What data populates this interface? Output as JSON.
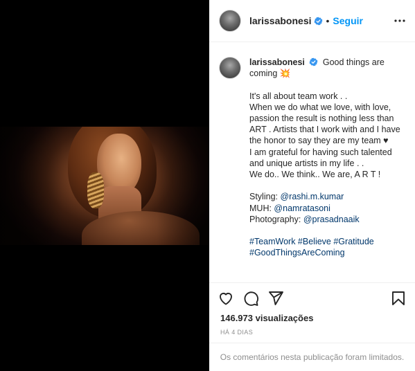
{
  "post": {
    "username": "larissabonesi",
    "follow_label": "Seguir",
    "dot": "•",
    "caption_lines": [
      "Good things are coming ",
      "It's all about team work . .",
      "When we do what we love, with love, passion the result is nothing less than ART . Artists that I work with and I have the honor to say they are my team ♥",
      "I am grateful for having such talented and unique artists in my life . .",
      "We do.. We think.. We are, A R T !"
    ],
    "emoji": "💥",
    "credits": [
      {
        "label": "Styling: ",
        "handle": "@rashi.m.kumar"
      },
      {
        "label": "MUH: ",
        "handle": "@namratasoni"
      },
      {
        "label": "Photography: ",
        "handle": "@prasadnaaik"
      }
    ],
    "hashtags_line1": "#TeamWork #Believe #Gratitude",
    "hashtags_line2": "#GoodThingsAreComing",
    "views_count": "146.973",
    "views_label": " visualizações",
    "time_ago": "HÁ 4 DIAS",
    "comments_limited": "Os comentários nesta publicação foram limitados."
  },
  "icons": {
    "like": "heart-icon",
    "comment": "comment-icon",
    "share": "share-icon",
    "save": "bookmark-icon",
    "more": "more-options-icon",
    "verified": "verified-badge-icon"
  },
  "colors": {
    "accent": "#0095f6",
    "verified": "#3897f0",
    "link": "#00376b",
    "muted": "#8e8e8e"
  }
}
